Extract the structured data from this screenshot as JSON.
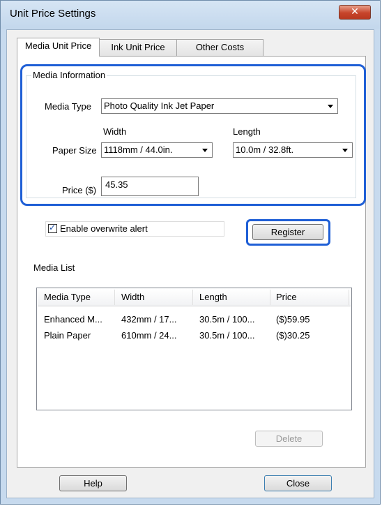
{
  "window": {
    "title": "Unit Price Settings",
    "close_glyph": "✕"
  },
  "tabs": [
    "Media Unit Price",
    "Ink Unit Price",
    "Other Costs"
  ],
  "media_info": {
    "legend": "Media Information",
    "media_type_label": "Media Type",
    "media_type_value": "Photo Quality Ink Jet Paper",
    "width_label": "Width",
    "length_label": "Length",
    "paper_size_label": "Paper Size",
    "width_value": "1118mm / 44.0in.",
    "length_value": "10.0m / 32.8ft.",
    "price_label": "Price ($)",
    "price_value": "45.35"
  },
  "overwrite_alert": {
    "label": "Enable overwrite alert",
    "checked": true,
    "check_glyph": "✓"
  },
  "register_button": "Register",
  "media_list": {
    "label": "Media List",
    "columns": [
      "Media Type",
      "Width",
      "Length",
      "Price"
    ],
    "rows": [
      [
        "Enhanced M...",
        "432mm / 17...",
        "30.5m / 100...",
        "($)59.95"
      ],
      [
        "Plain Paper",
        "610mm / 24...",
        "30.5m / 100...",
        "($)30.25"
      ]
    ]
  },
  "delete_button": "Delete",
  "help_button": "Help",
  "close_button": "Close",
  "colors": {
    "highlight": "#1f5fd6",
    "titlebar": "#c7daee",
    "close_button": "#c7452b"
  }
}
